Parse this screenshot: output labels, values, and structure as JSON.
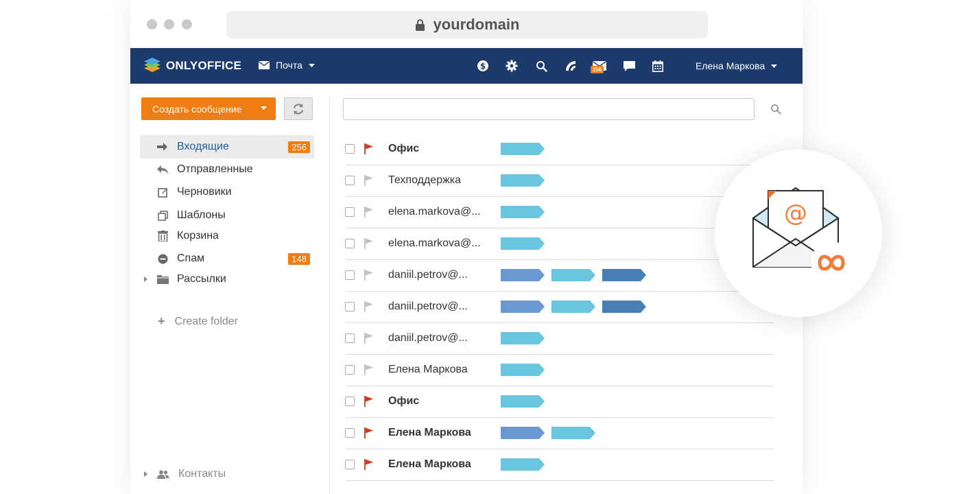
{
  "browser": {
    "url": "yourdomain"
  },
  "header": {
    "logo_text": "ONLYOFFICE",
    "module_label": "Почта",
    "mail_badge": "256",
    "user_name": "Елена Маркова",
    "icons": [
      "payments-icon",
      "settings-icon",
      "search-icon",
      "feed-icon",
      "mail-icon",
      "chat-icon",
      "calendar-icon"
    ]
  },
  "sidebar": {
    "create_label": "Создать сообщение",
    "folders": [
      {
        "label": "Входящие",
        "badge": "256",
        "icon": "inbox-arrow-icon",
        "active": true
      },
      {
        "label": "Отправленные",
        "badge": "",
        "icon": "reply-icon",
        "active": false
      },
      {
        "label": "Черновики",
        "badge": "",
        "icon": "draft-icon",
        "active": false
      },
      {
        "label": "Шаблоны",
        "badge": "",
        "icon": "templates-icon",
        "active": false
      },
      {
        "label": "Корзина",
        "badge": "",
        "icon": "trash-icon",
        "active": false
      },
      {
        "label": "Спам",
        "badge": "148",
        "icon": "spam-icon",
        "active": false
      },
      {
        "label": "Рассылки",
        "badge": "",
        "icon": "folder-icon",
        "active": false
      }
    ],
    "create_folder_label": "Create folder",
    "contacts_label": "Контакты"
  },
  "search": {
    "value": "",
    "placeholder": ""
  },
  "messages": [
    {
      "sender": "Офис",
      "unread": true,
      "flagged": true,
      "tags": [
        "light"
      ]
    },
    {
      "sender": "Техподдержка",
      "unread": false,
      "flagged": false,
      "tags": [
        "light"
      ]
    },
    {
      "sender": "elena.markova@...",
      "unread": false,
      "flagged": false,
      "tags": [
        "light"
      ]
    },
    {
      "sender": "elena.markova@...",
      "unread": false,
      "flagged": false,
      "tags": [
        "light"
      ]
    },
    {
      "sender": "daniil.petrov@...",
      "unread": false,
      "flagged": false,
      "tags": [
        "mid",
        "light",
        "dark"
      ]
    },
    {
      "sender": "daniil.petrov@...",
      "unread": false,
      "flagged": false,
      "tags": [
        "mid",
        "light",
        "dark"
      ]
    },
    {
      "sender": "daniil.petrov@...",
      "unread": false,
      "flagged": false,
      "tags": [
        "light"
      ]
    },
    {
      "sender": "Елена Маркова",
      "unread": false,
      "flagged": false,
      "tags": [
        "light"
      ]
    },
    {
      "sender": "Офис",
      "unread": true,
      "flagged": true,
      "tags": [
        "light"
      ]
    },
    {
      "sender": "Елена Маркова",
      "unread": true,
      "flagged": true,
      "tags": [
        "mid",
        "light"
      ]
    },
    {
      "sender": "Елена Маркова",
      "unread": true,
      "flagged": true,
      "tags": [
        "light"
      ]
    }
  ],
  "colors": {
    "header_bg": "#1c3b6c",
    "accent_orange": "#f07d12",
    "flag_red": "#d9381e",
    "flag_grey": "#c2c2c2",
    "tag_light": "#6ac6df",
    "tag_mid": "#6a98d3",
    "tag_dark": "#4a7fb5",
    "active_folder": "#1b5fa3"
  }
}
